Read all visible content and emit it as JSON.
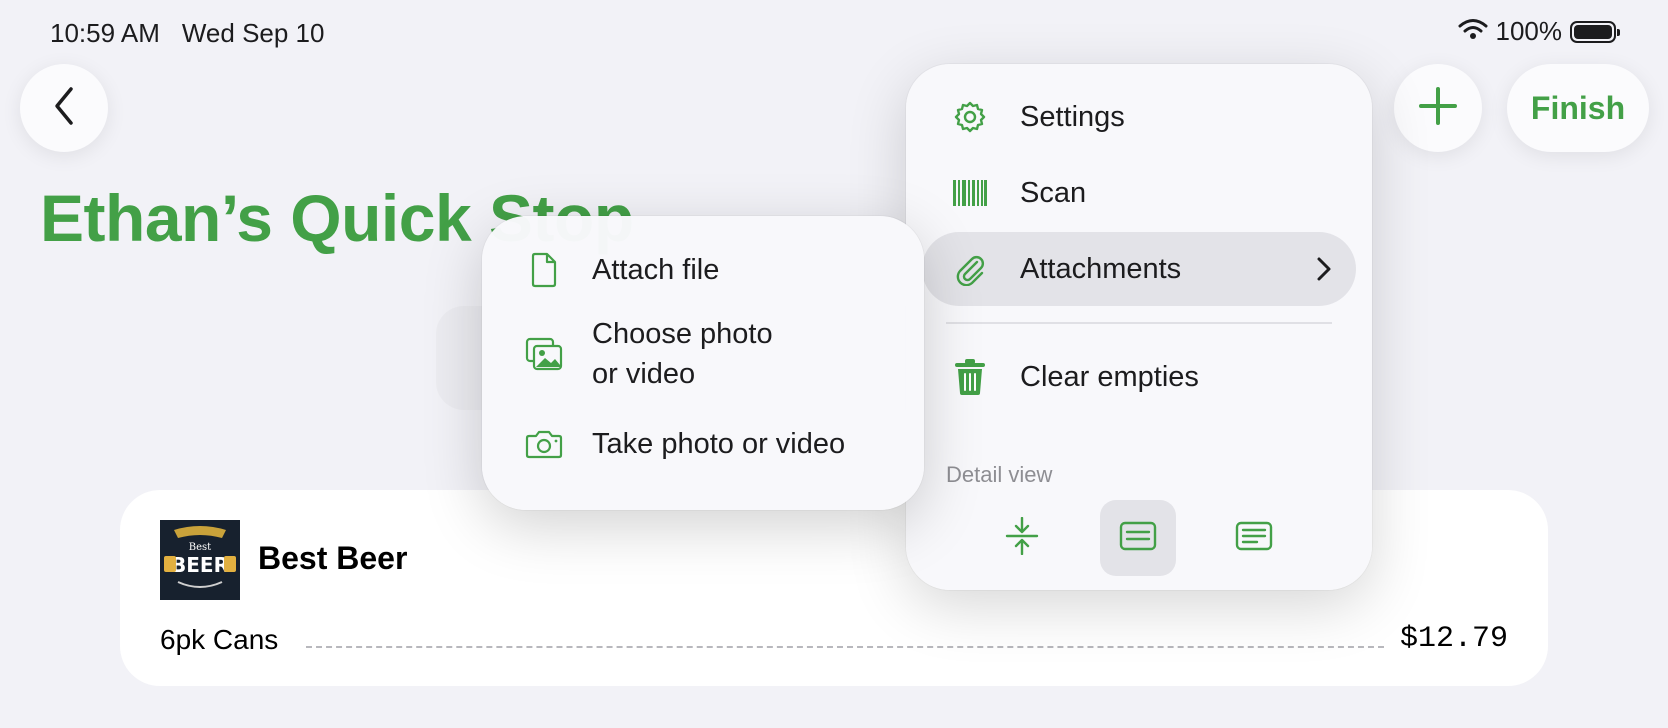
{
  "status_bar": {
    "time": "10:59 AM",
    "date": "Wed Sep 10",
    "battery": "100%",
    "battery_level": 1.0,
    "wifi_icon": "wifi-icon"
  },
  "nav": {
    "back_icon": "chevron-left-icon",
    "add_icon": "plus-icon",
    "finish_label": "Finish"
  },
  "page": {
    "title": "Ethan’s Quick Stop"
  },
  "item": {
    "name": "Best Beer",
    "variant": "6pk Cans",
    "price": "$12.79",
    "thumb_text_top": "Best",
    "thumb_text_main": "BEER"
  },
  "menu": {
    "items": [
      {
        "label": "Settings",
        "icon": "gear-icon"
      },
      {
        "label": "Scan",
        "icon": "barcode-icon"
      },
      {
        "label": "Attachments",
        "icon": "paperclip-icon"
      },
      {
        "label": "Clear empties",
        "icon": "trash-icon"
      }
    ],
    "section_label": "Detail view",
    "detail_options": [
      {
        "icon": "compact-view-icon",
        "selected": false
      },
      {
        "icon": "card-view-icon",
        "selected": true
      },
      {
        "icon": "expanded-view-icon",
        "selected": false
      }
    ]
  },
  "submenu": {
    "items": [
      {
        "label": "Attach file",
        "icon": "document-icon"
      },
      {
        "label": "Choose photo or video",
        "icon": "photo-library-icon"
      },
      {
        "label": "Take photo or video",
        "icon": "camera-icon"
      }
    ]
  },
  "colors": {
    "accent": "#43a047",
    "background": "#f2f2f7"
  }
}
